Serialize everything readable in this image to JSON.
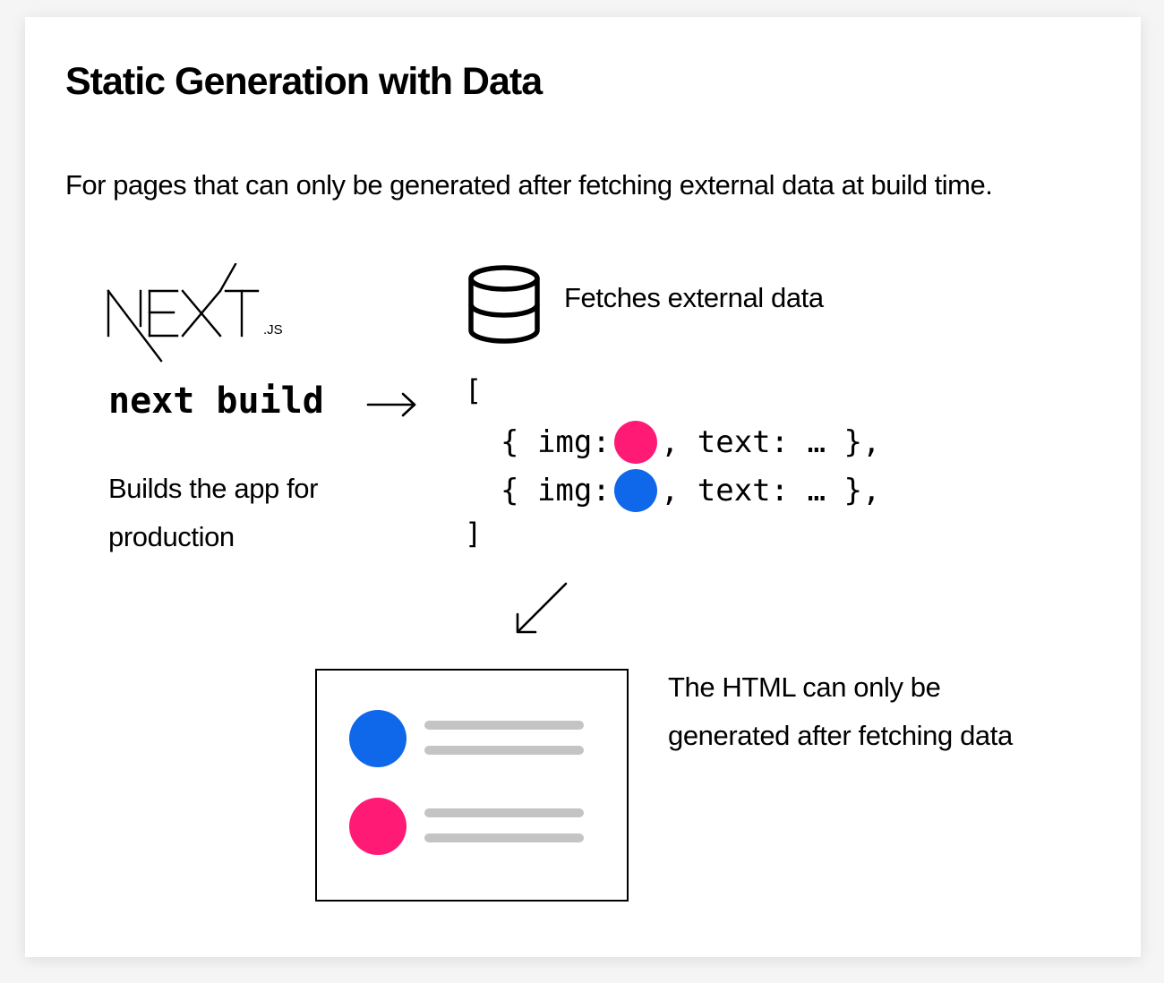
{
  "title": "Static Generation with Data",
  "subtitle": "For pages that can only be generated after fetching external data at build time.",
  "logo": {
    "word": "NEXT",
    "suffix": ".JS"
  },
  "build": {
    "command": "next build",
    "description_line1": "Builds the app for",
    "description_line2": "production"
  },
  "fetch": {
    "label": "Fetches external data"
  },
  "code": {
    "open_bracket": "[",
    "close_bracket": "]",
    "rows": [
      {
        "prefix": "{ img:",
        "suffix": ", text: … },",
        "dot_color": "#ff1a76"
      },
      {
        "prefix": "{ img:",
        "suffix": ", text: … },",
        "dot_color": "#0f67ea"
      }
    ]
  },
  "output": {
    "description_line1": "The HTML can only be",
    "description_line2": "generated after fetching data",
    "items": [
      {
        "dot_color": "#0f67ea"
      },
      {
        "dot_color": "#ff1a76"
      }
    ],
    "line_color": "#c4c4c4"
  },
  "icons": {
    "database": "database-icon",
    "arrow_right": "arrow-right-icon",
    "arrow_down_left": "arrow-down-left-icon"
  }
}
